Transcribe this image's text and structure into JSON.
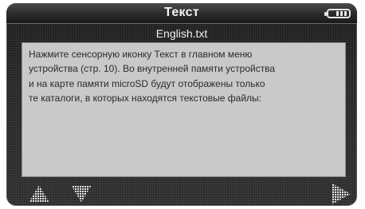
{
  "header": {
    "title": "Текст",
    "battery_icon": "battery-icon"
  },
  "document": {
    "filename": "English.txt",
    "lines": [
      "Нажмите сенсорную иконку Текст в главном меню",
      "устройства (стр. 10). Во внутренней памяти устройства",
      "и на карте памяти microSD будут отображены только",
      "те каталоги, в которых находятся текстовые файлы:"
    ]
  },
  "controls": {
    "page_up_icon": "arrow-up-icon",
    "page_down_icon": "arrow-down-icon",
    "next_icon": "arrow-right-icon"
  },
  "colors": {
    "text_area": "#c9c9c9",
    "background": "#2d2d2d",
    "icon": "#e0e0e0"
  }
}
